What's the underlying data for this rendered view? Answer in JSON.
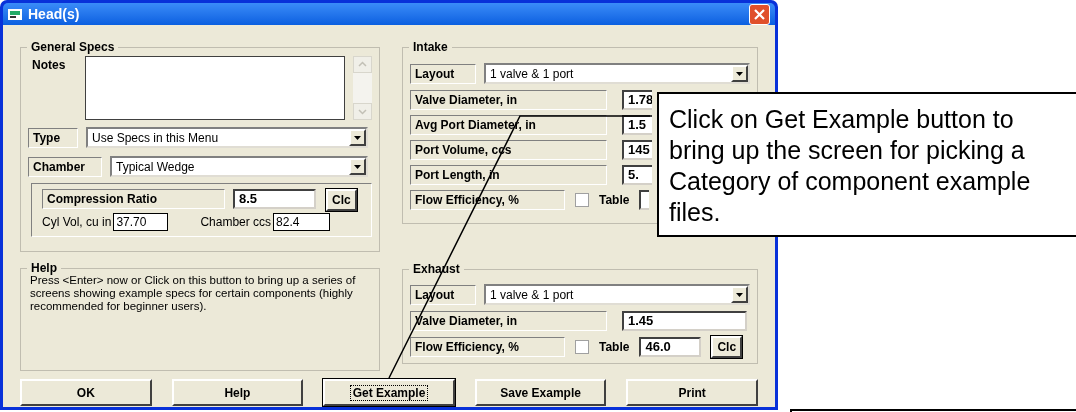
{
  "window": {
    "title": "Head(s)"
  },
  "general_specs": {
    "title": "General Specs",
    "notes_label": "Notes",
    "type": {
      "label": "Type",
      "value": "Use Specs in this Menu"
    },
    "chamber": {
      "label": "Chamber",
      "value": "Typical Wedge"
    },
    "compression": {
      "label": "Compression Ratio",
      "value": "8.5",
      "button": "Clc"
    },
    "cyl_vol": {
      "label": "Cyl Vol, cu in",
      "value": "37.70"
    },
    "chamber_ccs": {
      "label": "Chamber ccs",
      "value": "82.4"
    }
  },
  "help": {
    "title": "Help",
    "text": "Press <Enter> now or Click on this button to bring up a series of screens showing example specs for certain components (highly recommended for beginner users)."
  },
  "intake": {
    "title": "Intake",
    "layout": {
      "label": "Layout",
      "value": "1 valve & 1 port"
    },
    "rows": [
      {
        "kind": "field",
        "label": "Valve Diameter, in",
        "value": "1.78"
      },
      {
        "kind": "field",
        "label": "Avg Port Diameter, in",
        "value": "1.5"
      },
      {
        "kind": "field",
        "label": "Port Volume, ccs",
        "value": "145"
      },
      {
        "kind": "field",
        "label": "Port Length, in",
        "value": "5."
      },
      {
        "kind": "flow",
        "label": "Flow Efficiency, %",
        "checked": false,
        "table_label": "Table"
      }
    ]
  },
  "exhaust": {
    "title": "Exhaust",
    "layout": {
      "label": "Layout",
      "value": "1 valve & 1 port"
    },
    "rows": [
      {
        "kind": "field",
        "label": "Valve Diameter, in",
        "value": "1.45"
      },
      {
        "kind": "flow",
        "label": "Flow Efficiency, %",
        "checked": false,
        "table_label": "Table",
        "value": "46.0",
        "button": "Clc"
      }
    ]
  },
  "buttons": [
    {
      "label": "OK",
      "focused": false
    },
    {
      "label": "Help",
      "focused": false
    },
    {
      "label": "Get Example",
      "focused": true
    },
    {
      "label": "Save Example",
      "focused": false
    },
    {
      "label": "Print",
      "focused": false
    }
  ],
  "callout": {
    "text": "Click on Get Example button to bring up the screen for picking a Category of component example files."
  }
}
